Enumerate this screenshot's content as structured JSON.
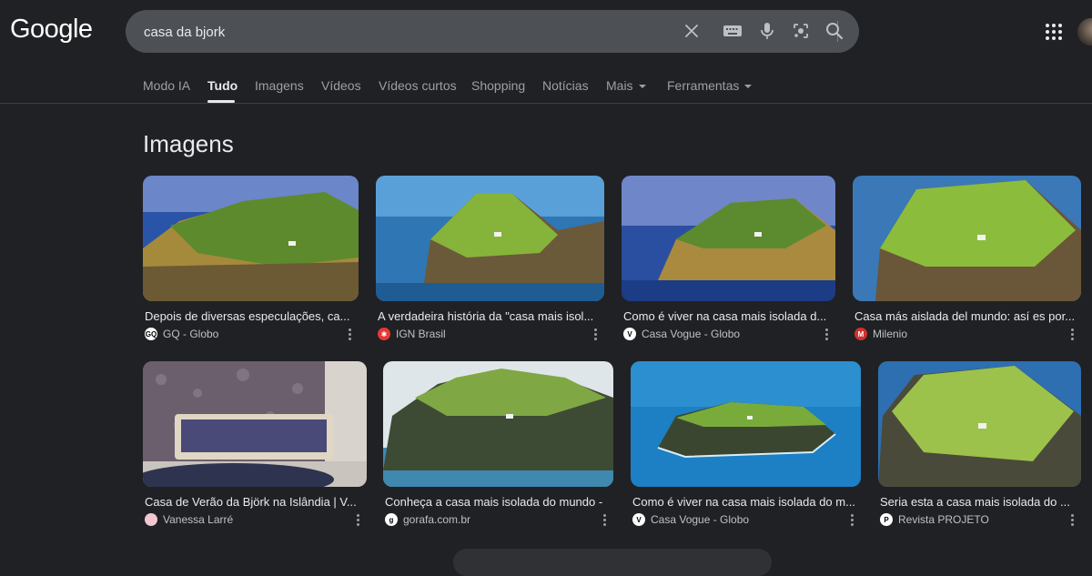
{
  "header": {
    "logo": "Google",
    "search": {
      "value": "casa da bjork",
      "placeholder": ""
    }
  },
  "tabs": [
    {
      "label": "Modo IA",
      "active": false
    },
    {
      "label": "Tudo",
      "active": true
    },
    {
      "label": "Imagens",
      "active": false
    },
    {
      "label": "Vídeos",
      "active": false
    },
    {
      "label": "Vídeos curtos",
      "active": false
    },
    {
      "label": "Shopping",
      "active": false
    },
    {
      "label": "Notícias",
      "active": false
    },
    {
      "label": "Mais",
      "active": false
    },
    {
      "label": "Ferramentas",
      "active": false
    }
  ],
  "section": {
    "title": "Imagens"
  },
  "images": [
    {
      "caption": "Depois de diversas especulações, ca...",
      "source": "GQ - Globo",
      "favicon": "GQ"
    },
    {
      "caption": "A verdadeira história da \"casa mais isol...",
      "source": "IGN Brasil",
      "favicon": "IGN"
    },
    {
      "caption": "Como é viver na casa mais isolada d...",
      "source": "Casa Vogue - Globo",
      "favicon": "V"
    },
    {
      "caption": "Casa más aislada del mundo: así es por...",
      "source": "Milenio",
      "favicon": "M"
    },
    {
      "caption": "Casa de Verão da Björk na Islândia | V...",
      "source": "Vanessa Larré",
      "favicon": ""
    },
    {
      "caption": "Conheça a casa mais isolada do mundo -",
      "source": "gorafa.com.br",
      "favicon": "g"
    },
    {
      "caption": "Como é viver na casa mais isolada do m...",
      "source": "Casa Vogue - Globo",
      "favicon": "V"
    },
    {
      "caption": "Seria esta a casa mais isolada do ...",
      "source": "Revista PROJETO",
      "favicon": "P"
    }
  ],
  "colors": {
    "background": "#202124",
    "searchbar": "#4d5156",
    "text": "#e8eaed",
    "muted": "#9aa0a6"
  },
  "icons": [
    "clear-icon",
    "keyboard-icon",
    "mic-icon",
    "lens-icon",
    "search-icon",
    "apps-icon",
    "more-vert-icon"
  ]
}
